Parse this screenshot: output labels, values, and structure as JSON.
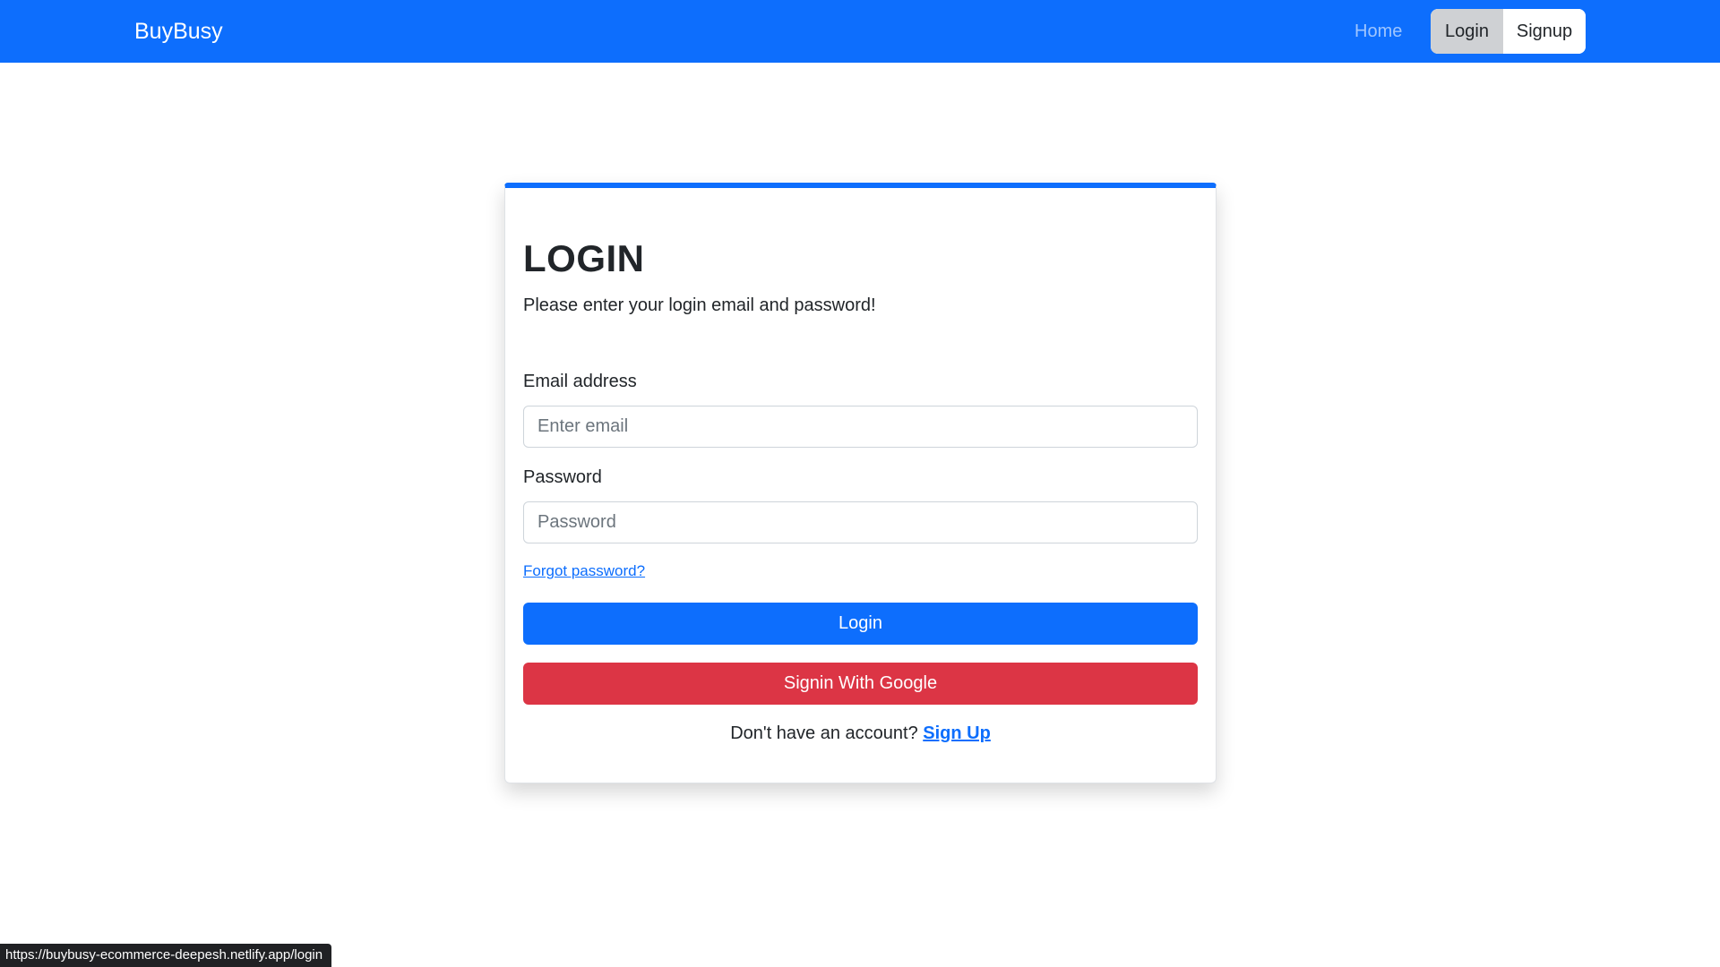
{
  "navbar": {
    "brand": "BuyBusy",
    "home_label": "Home",
    "login_label": "Login",
    "signup_label": "Signup"
  },
  "card": {
    "title": "LOGIN",
    "subtitle": "Please enter your login email and password!",
    "email_label": "Email address",
    "email_placeholder": "Enter email",
    "password_label": "Password",
    "password_placeholder": "Password",
    "forgot_label": "Forgot password?",
    "login_button": "Login",
    "google_button": "Signin With Google",
    "no_account_text": "Don't have an account? ",
    "signup_link": "Sign Up"
  },
  "status_bar": {
    "url": "https://buybusy-ecommerce-deepesh.netlify.app/login"
  },
  "colors": {
    "primary": "#0d6efd",
    "danger": "#dc3545"
  }
}
